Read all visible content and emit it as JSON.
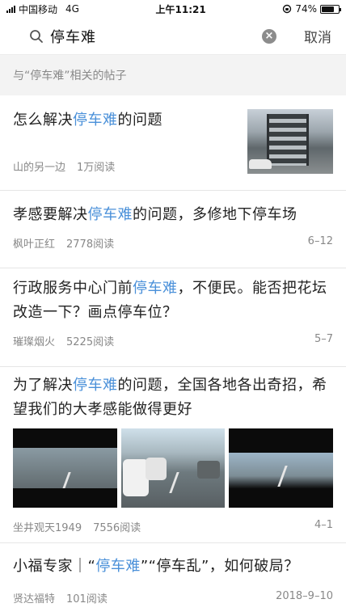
{
  "status_bar": {
    "carrier": "中国移动",
    "network": "4G",
    "time": "上午11:21",
    "battery": "74%",
    "battery_level": 0.74
  },
  "search": {
    "query": "停车难",
    "cancel_label": "取消"
  },
  "context": {
    "text": "与“停车难”相关的帖子"
  },
  "posts": [
    {
      "title_before": "怎么解决",
      "title_hl": "停车难",
      "title_after": "的问题",
      "author": "山的另一边",
      "reads": "1万阅读",
      "date": ""
    },
    {
      "title_before": "孝感要解决",
      "title_hl": "停车难",
      "title_after": "的问题，多修地下停车场",
      "author": "枫叶正红",
      "reads": "2778阅读",
      "date": "6–12"
    },
    {
      "title_before": "行政服务中心门前",
      "title_hl": "停车难",
      "title_after": "，不便民。能否把花坛改造一下？画点停车位？",
      "author": "璀璨烟火",
      "reads": "5225阅读",
      "date": "5–7"
    },
    {
      "title_before": "为了解决",
      "title_hl": "停车难",
      "title_after": "的问题，全国各地各出奇招，希望我们的大孝感能做得更好",
      "author": "坐井观天1949",
      "reads": "7556阅读",
      "date": "4–1"
    },
    {
      "title_before": "小福专家｜“",
      "title_hl": "停车难",
      "title_after": "”“停车乱”，如何破局？",
      "author": "贤达福特",
      "reads": "101阅读",
      "date": "2018–9–10"
    }
  ],
  "colors": {
    "highlight": "#4a90d9",
    "meta": "#888888",
    "divider": "#e6e6e6",
    "context_bg": "#f3f3f3"
  }
}
